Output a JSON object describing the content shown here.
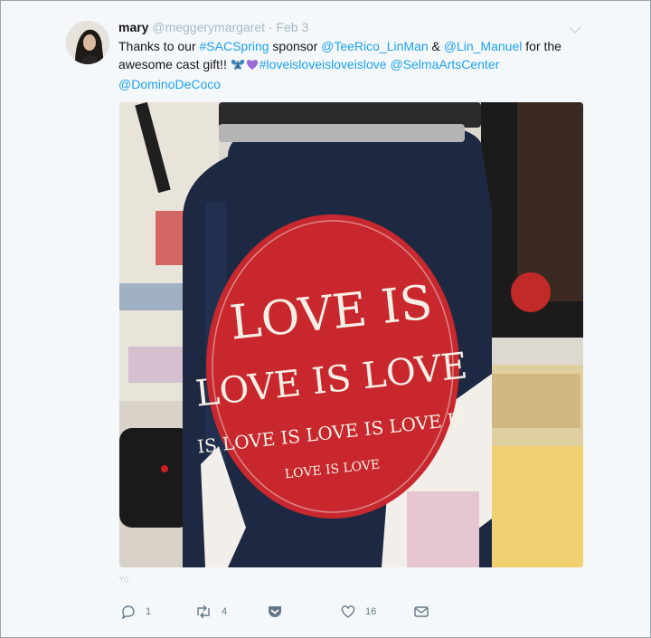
{
  "tweet": {
    "author_name": "mary",
    "author_handle": "@meggerymargaret",
    "separator": "·",
    "date": "Feb 3",
    "text_parts": [
      {
        "text": "Thanks to our ",
        "link": false
      },
      {
        "text": "#SACSpring",
        "link": true
      },
      {
        "text": " sponsor ",
        "link": false
      },
      {
        "text": "@TeeRico_LinMan",
        "link": true
      },
      {
        "text": " & ",
        "link": false
      },
      {
        "text": "@Lin_Manuel",
        "link": true
      },
      {
        "text": " for the awesome cast gift!! ",
        "link": false
      },
      {
        "text": "#loveisloveisloveislove",
        "link": true
      },
      {
        "text": " ",
        "link": false
      },
      {
        "text": "@SelmaArtsCenter",
        "link": true
      },
      {
        "text": " ",
        "link": false
      },
      {
        "text": "@DominoDeCoco",
        "link": true
      }
    ],
    "emoji": [
      "butterfly-emoji",
      "purple-heart-emoji"
    ],
    "photo_sticker_lines": [
      "LOVE IS",
      "LOVE IS LOVE",
      "IS LOVE IS LOVE IS LOVE IS",
      "LOVE IS LOVE"
    ],
    "footer_label": "Yo",
    "counts": {
      "replies": "1",
      "retweets": "4",
      "likes": "16"
    },
    "colors": {
      "link": "#1da1f2",
      "muted": "#aab8c2",
      "icon": "#657786",
      "sticker_red": "#c8282d"
    }
  }
}
